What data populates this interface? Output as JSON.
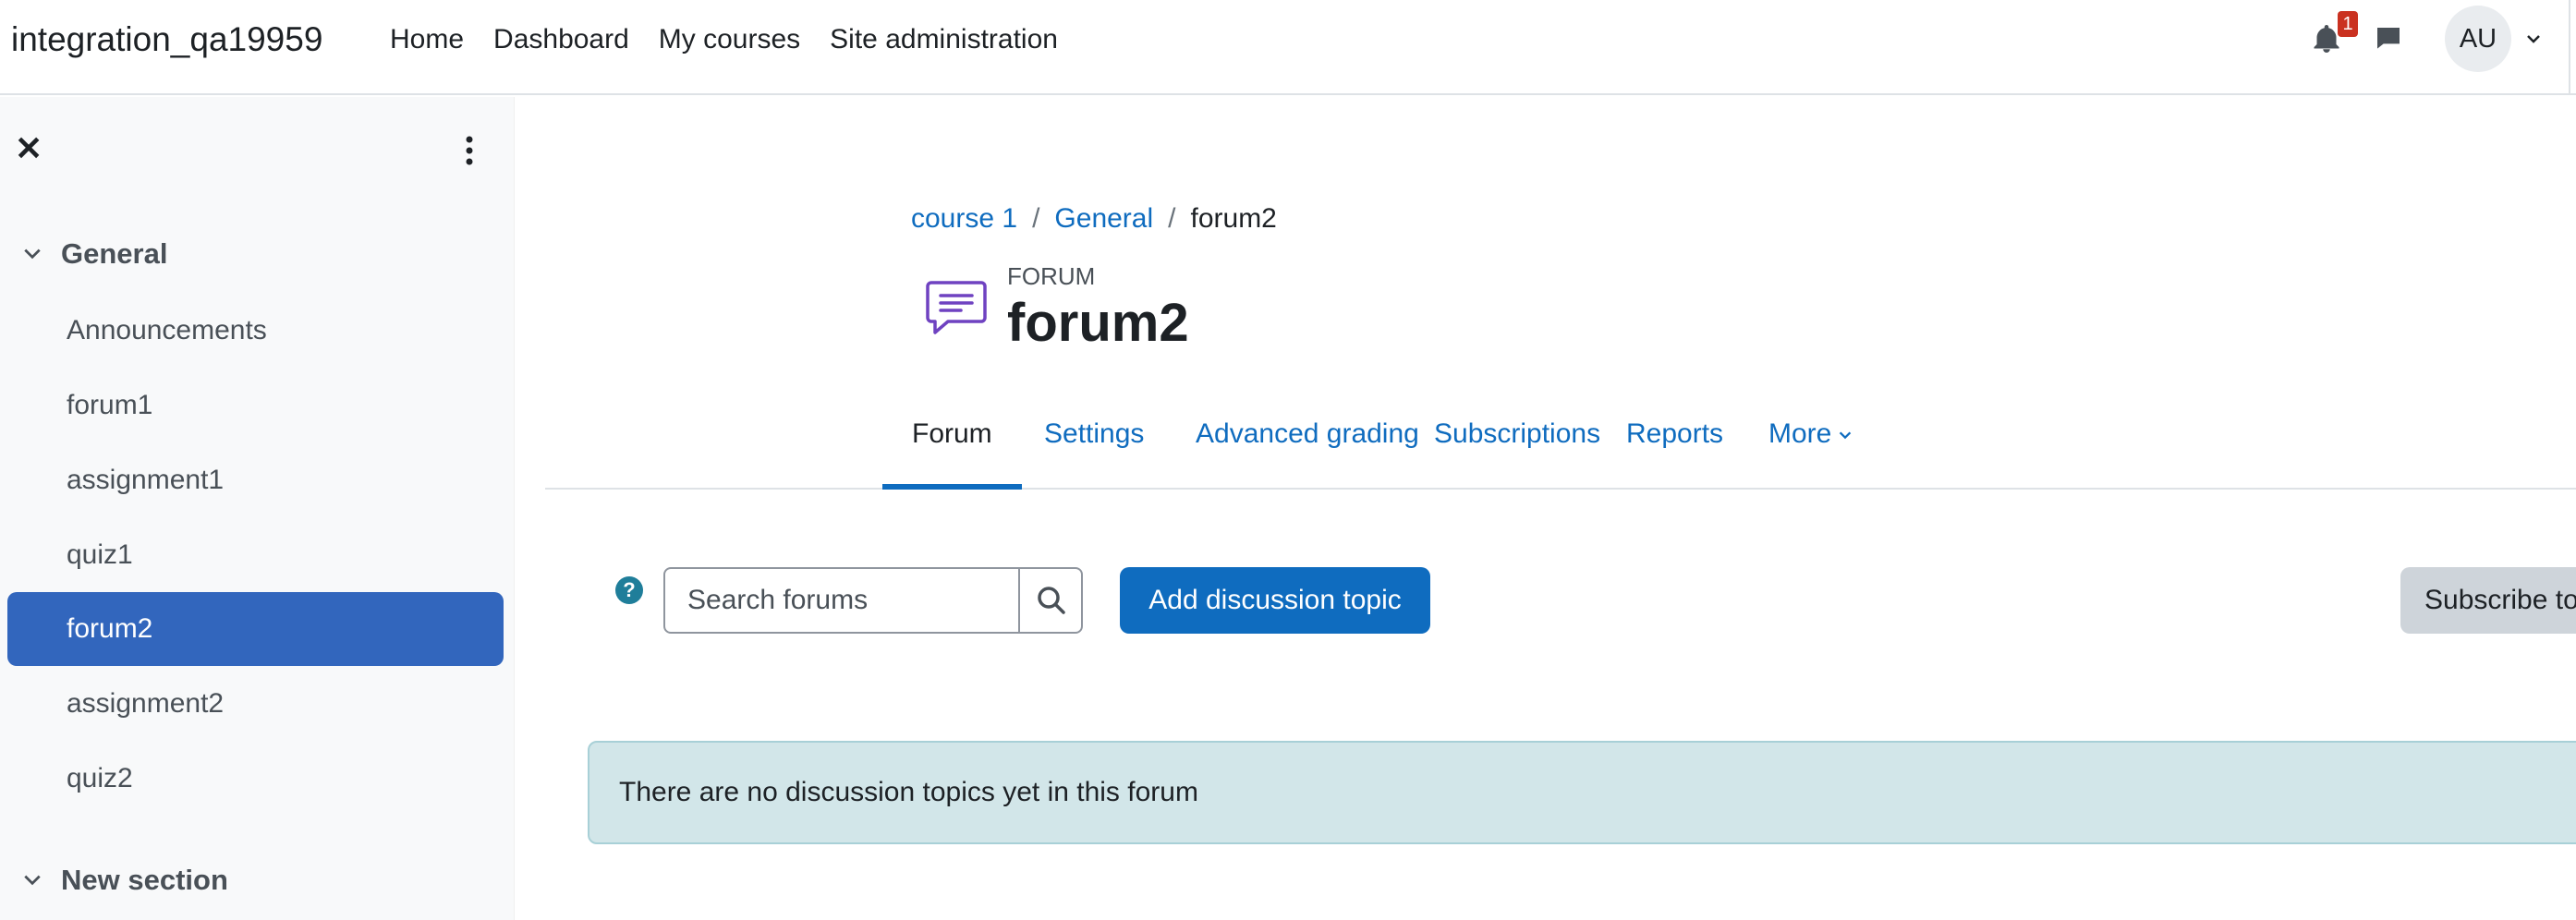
{
  "header": {
    "site_name": "integration_qa19959",
    "nav": [
      "Home",
      "Dashboard",
      "My courses",
      "Site administration"
    ],
    "notifications_count": "1",
    "user_initials": "AU"
  },
  "drawer": {
    "sections": [
      {
        "title": "General",
        "items": [
          "Announcements",
          "forum1",
          "assignment1",
          "quiz1",
          "forum2",
          "assignment2",
          "quiz2"
        ],
        "active_item": "forum2"
      },
      {
        "title": "New section",
        "items": []
      }
    ]
  },
  "breadcrumb": [
    "course 1",
    "General",
    "forum2"
  ],
  "activity": {
    "type": "FORUM",
    "title": "forum2",
    "icon": "forum-icon"
  },
  "tabs": [
    "Forum",
    "Settings",
    "Advanced grading",
    "Subscriptions",
    "Reports",
    "More"
  ],
  "active_tab": "Forum",
  "toolbar": {
    "help_icon": "?",
    "search_placeholder": "Search forums",
    "add_label": "Add discussion topic",
    "subscribe_label": "Subscribe to forum"
  },
  "notice": "There are no discussion topics yet in this forum",
  "colors": {
    "primary": "#0f6cbf",
    "drawer_active": "#3266bd",
    "alert_bg": "#d2e6e9",
    "badge": "#ca3120"
  }
}
